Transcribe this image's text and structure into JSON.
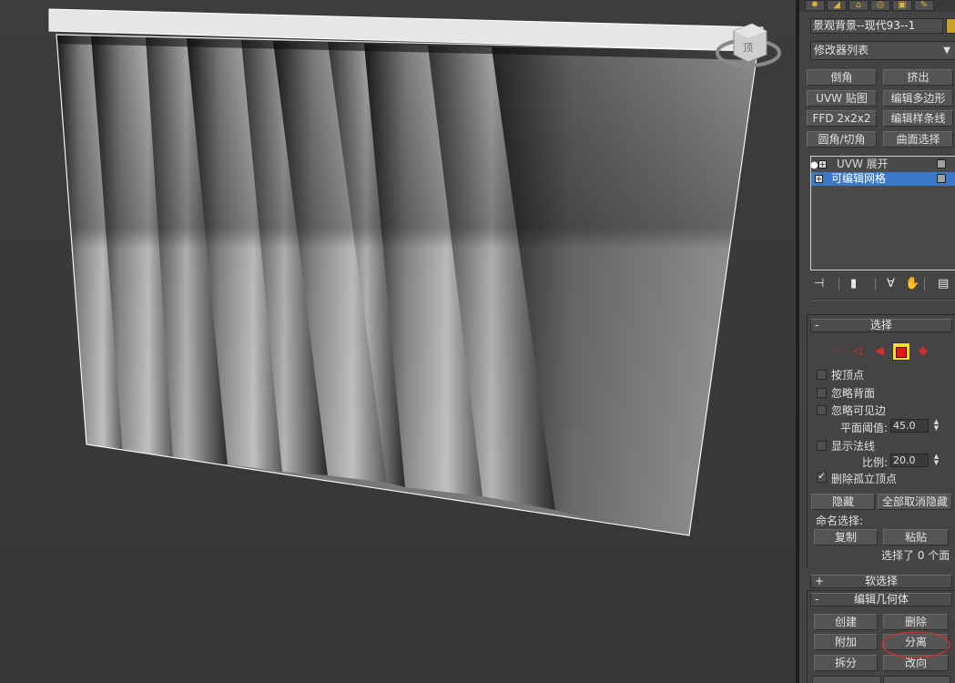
{
  "viewport": {
    "view_cube_label": "顶"
  },
  "panel": {
    "object_name": "景观背景--现代93--1",
    "modifier_list": "修改器列表",
    "modifier_buttons": [
      "倒角",
      "挤出",
      "UVW 贴图",
      "编辑多边形",
      "FFD 2x2x2",
      "编辑样条线",
      "圆角/切角",
      "曲面选择"
    ],
    "stack": [
      {
        "label": "UVW 展开",
        "selected": false
      },
      {
        "label": "可编辑网格",
        "selected": true
      }
    ],
    "selection": {
      "title": "选择",
      "sign": "-",
      "options": [
        {
          "label": "按顶点",
          "checked": false
        },
        {
          "label": "忽略背面",
          "checked": false
        },
        {
          "label": "忽略可见边",
          "checked": false
        }
      ],
      "planar_threshold_label": "平面阈值:",
      "planar_threshold_value": "45.0",
      "show_normals_label": "显示法线",
      "show_normals_checked": false,
      "scale_label": "比例:",
      "scale_value": "20.0",
      "delete_isolated_label": "删除孤立顶点",
      "delete_isolated_checked": true,
      "hide_button": "隐藏",
      "unhide_all_button": "全部取消隐藏",
      "named_selection_label": "命名选择:",
      "copy_button": "复制",
      "paste_button": "粘贴",
      "status": "选择了 0 个面"
    },
    "soft_selection": {
      "title": "软选择",
      "sign": "+"
    },
    "edit_geometry": {
      "title": "编辑几何体",
      "sign": "-",
      "create_button": "创建",
      "delete_button": "删除",
      "attach_button": "附加",
      "detach_button": "分离",
      "divide_button": "拆分",
      "turn_button": "改向"
    }
  },
  "colors": {
    "highlight_circle": "#c83232",
    "selected_row": "#3a78c8",
    "object_color": "#c8a028"
  }
}
